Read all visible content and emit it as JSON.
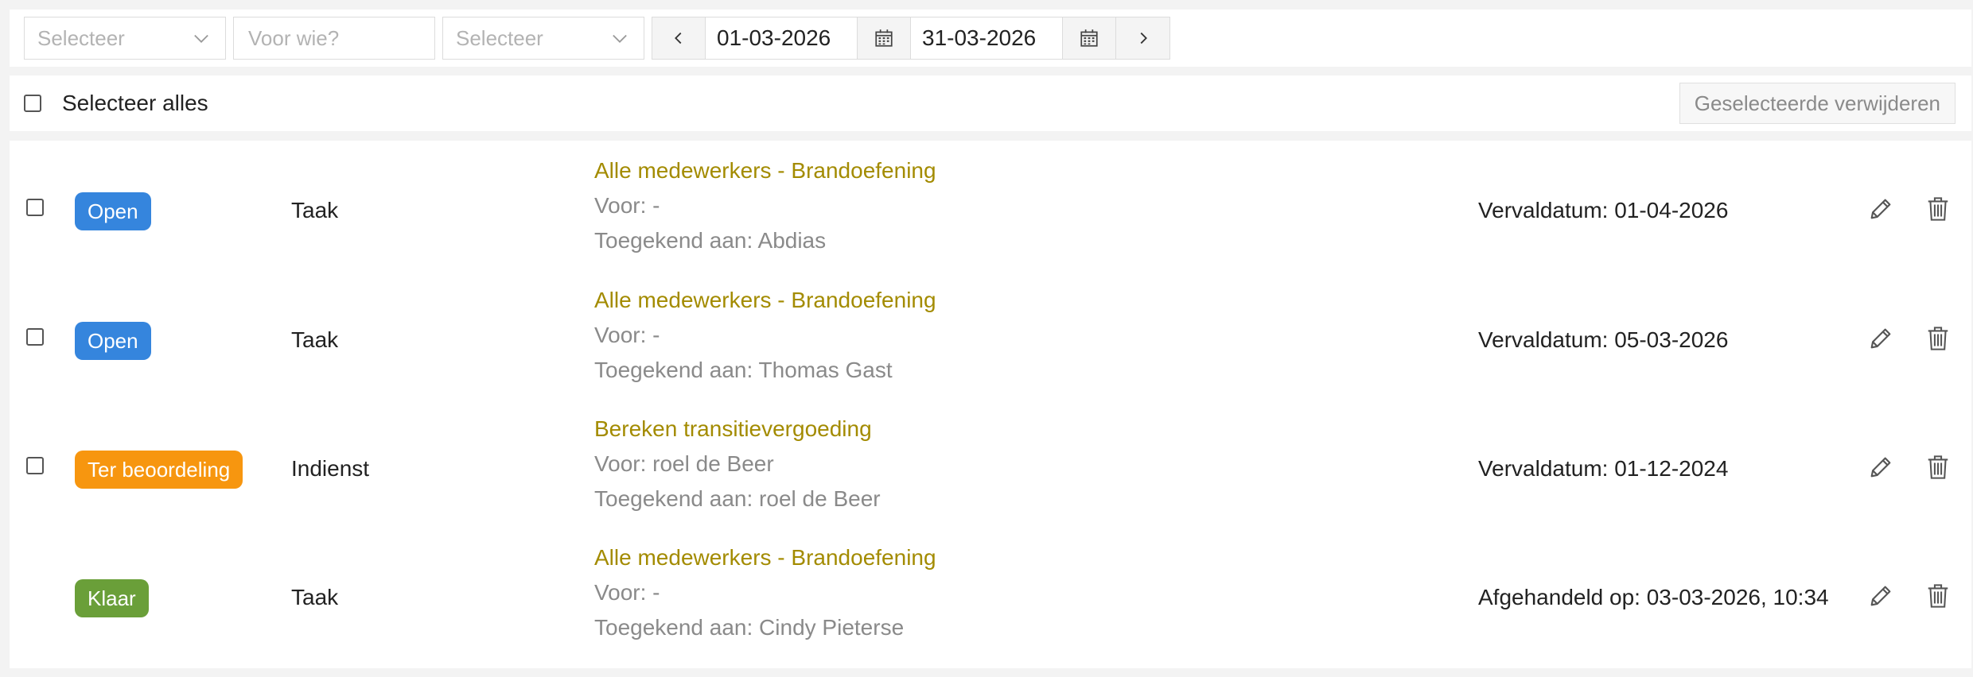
{
  "filters": {
    "select1_placeholder": "Selecteer",
    "for_whom_placeholder": "Voor wie?",
    "select2_placeholder": "Selecteer",
    "date_from": "01-03-2026",
    "date_to": "31-03-2026"
  },
  "bulk": {
    "select_all_label": "Selecteer alles",
    "delete_selected_label": "Geselecteerde verwijderen"
  },
  "status_colors": {
    "open": "#3585dd",
    "review": "#f7960f",
    "done": "#6a9f39"
  },
  "rows": [
    {
      "status": "Open",
      "type": "Taak",
      "title": "Alle medewerkers - Brandoefening",
      "for": "Voor: -",
      "assigned": "Toegekend aan: Abdias",
      "date": "Vervaldatum: 01-04-2026"
    },
    {
      "status": "Open",
      "type": "Taak",
      "title": "Alle medewerkers - Brandoefening",
      "for": "Voor: -",
      "assigned": "Toegekend aan: Thomas Gast",
      "date": "Vervaldatum: 05-03-2026"
    },
    {
      "status": "Ter beoordeling",
      "type": "Indienst",
      "title": "Bereken transitievergoeding",
      "for": "Voor: roel de Beer",
      "assigned": "Toegekend aan: roel de Beer",
      "date": "Vervaldatum: 01-12-2024"
    },
    {
      "status": "Klaar",
      "type": "Taak",
      "title": "Alle medewerkers - Brandoefening",
      "for": "Voor: -",
      "assigned": "Toegekend aan: Cindy Pieterse",
      "date": "Afgehandeld op: 03-03-2026, 10:34"
    }
  ]
}
